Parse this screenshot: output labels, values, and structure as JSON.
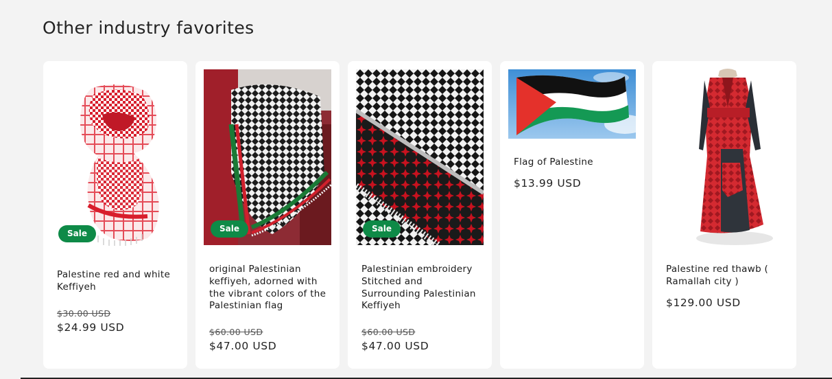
{
  "section": {
    "title": "Other industry favorites"
  },
  "colors": {
    "sale_badge": "#0e8a47",
    "card_bg": "#ffffff",
    "page_bg": "#f3f3f3"
  },
  "products": [
    {
      "title": "Palestine red and white Keffiyeh",
      "badge": "Sale",
      "regular_price": "$30.00 USD",
      "sale_price": "$24.99 USD",
      "image_icon": "red-white-keffiyeh-image"
    },
    {
      "title": "original Palestinian keffiyeh, adorned with the vibrant colors of the Palestinian flag",
      "badge": "Sale",
      "regular_price": "$60.00 USD",
      "sale_price": "$47.00 USD",
      "image_icon": "flag-color-keffiyeh-image"
    },
    {
      "title": "Palestinian embroidery Stitched and Surrounding Palestinian Keffiyeh",
      "badge": "Sale",
      "regular_price": "$60.00 USD",
      "sale_price": "$47.00 USD",
      "image_icon": "embroidered-keffiyeh-image"
    },
    {
      "title": "Flag of Palestine",
      "price": "$13.99 USD",
      "image_icon": "palestine-flag-image"
    },
    {
      "title": "Palestine red thawb ( Ramallah city )",
      "price": "$129.00 USD",
      "image_icon": "red-thawb-dress-image"
    }
  ]
}
